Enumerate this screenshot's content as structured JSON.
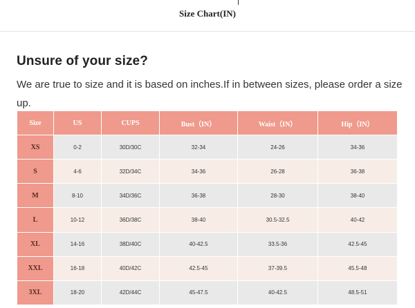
{
  "header": {
    "title": "Size Chart(IN)"
  },
  "heading": "Unsure of your size?",
  "description": "We are true to size and it is based on inches.If in between sizes, please order a size up.",
  "table": {
    "columns": [
      "Size",
      "US",
      "CUPS",
      "Bust（IN）",
      "Waist（IN）",
      "Hip（IN）"
    ],
    "rows": [
      [
        "XS",
        "0-2",
        "30D/30C",
        "32-34",
        "24-26",
        "34-36"
      ],
      [
        "S",
        "4-6",
        "32D/34C",
        "34-36",
        "26-28",
        "36-38"
      ],
      [
        "M",
        "8-10",
        "34D/36C",
        "36-38",
        "28-30",
        "38-40"
      ],
      [
        "L",
        "10-12",
        "36D/38C",
        "38-40",
        "30.5-32.5",
        "40-42"
      ],
      [
        "XL",
        "14-16",
        "38D/40C",
        "40-42.5",
        "33.5-36",
        "42.5-45"
      ],
      [
        "XXL",
        "16-18",
        "40D/42C",
        "42.5-45",
        "37-39.5",
        "45.5-48"
      ],
      [
        "3XL",
        "18-20",
        "42D/44C",
        "45-47.5",
        "40-42.5",
        "48.5-51"
      ]
    ]
  },
  "colors": {
    "header_row": "#ef9a8c",
    "row_odd": "#e9e9e9",
    "row_even": "#f7ede6"
  }
}
